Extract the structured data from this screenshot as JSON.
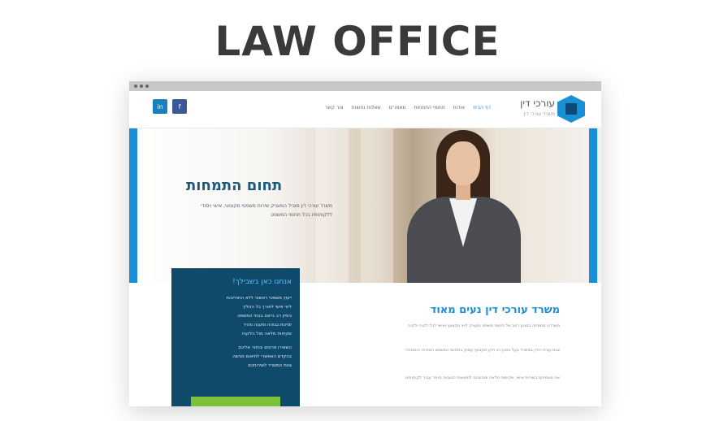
{
  "page": {
    "title": "LAW OFFICE"
  },
  "site": {
    "logo_text": "עורכי דין",
    "logo_subtext": "משרד עורכי דין",
    "nav": [
      {
        "label": "דף הבית",
        "active": true
      },
      {
        "label": "אודות",
        "active": false
      },
      {
        "label": "תחומי התמחות",
        "active": false
      },
      {
        "label": "מאמרים",
        "active": false
      },
      {
        "label": "שאלות נפוצות",
        "active": false
      },
      {
        "label": "צור קשר",
        "active": false
      }
    ],
    "social": [
      {
        "label": "in",
        "icon": "linkedin-icon",
        "color": "#1a7fbf"
      },
      {
        "label": "f",
        "icon": "facebook-icon",
        "color": "#3b5998"
      }
    ],
    "hero": {
      "title": "תחום התמחות",
      "text": "משרד עורכי דין מוביל המעניק שירות משפטי מקצועי, אישי ויסודי ללקוחותיו בכל תחומי המשפט"
    },
    "contact": {
      "title": "אנחנו כאן בשבילך!",
      "lines_a": [
        "ייעוץ משפטי ראשוני ללא התחייבות",
        "ליווי אישי לאורך כל ההליך",
        "ניסיון רב בייצוג בבתי המשפט",
        "זמינות גבוהה ומענה מהיר",
        "שקיפות מלאה מול הלקוח"
      ],
      "lines_b": [
        "השאירו פרטים ונחזור אליכם",
        "בהקדם האפשרי לתיאום פגישה",
        "צוות המשרד לשירותכם"
      ],
      "button_color": "#7bc23a"
    },
    "section": {
      "title": "משרד עורכי דין נעים מאוד",
      "paragraphs": [
        "משרדנו מתמחה במגוון רחב של תחומי משפט ומעניק ליווי מקצועי ואישי לכל לקוח ולקוח",
        "צוות עורכי הדין במשרד בעל ניסיון רב וידע מקצועי עמוק בתחומי המשפט האזרחי והמסחרי",
        "אנו מאמינים בשירות אישי, שקיפות מלאה ומחויבות לתוצאות הטובות ביותר עבור לקוחותינו"
      ]
    }
  },
  "colors": {
    "accent": "#1a8fd6",
    "dark_panel": "#0f4a6a",
    "title_gray": "#3a3a3a"
  }
}
